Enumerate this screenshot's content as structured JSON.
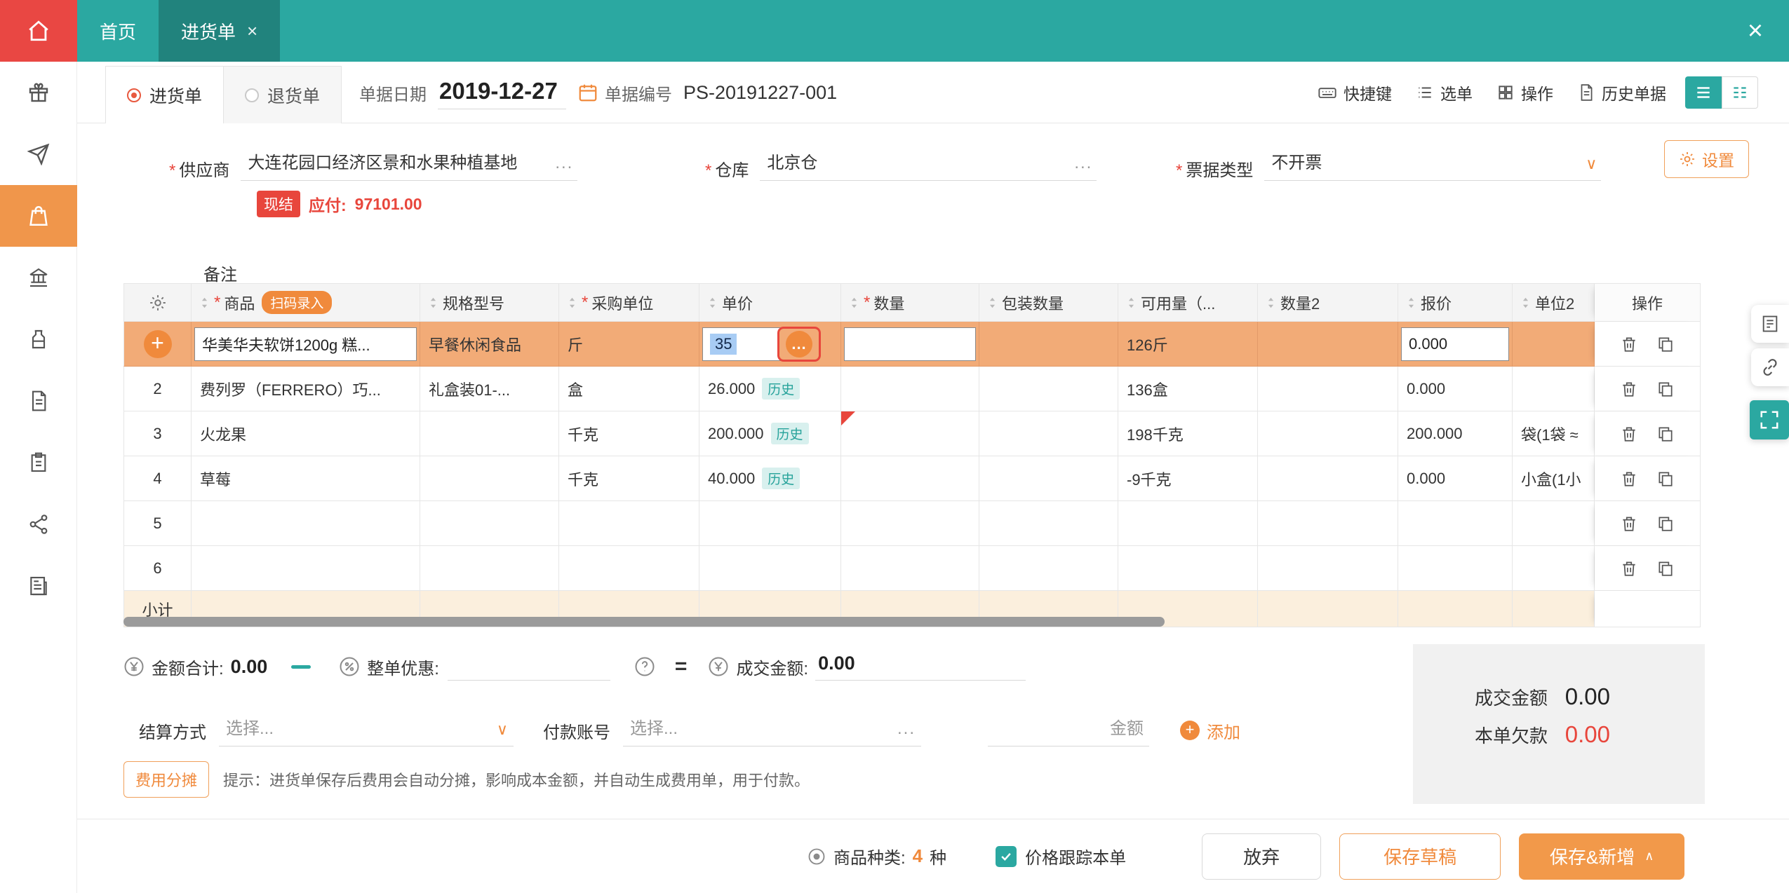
{
  "topbar": {
    "home_tab": "首页",
    "doc_tab": "进货单",
    "tab_close": "×",
    "close": "×"
  },
  "subheader": {
    "purchase_radio": "进货单",
    "return_radio": "退货单",
    "date_label": "单据日期",
    "date_value": "2019-12-27",
    "number_label": "单据编号",
    "number_value": "PS-20191227-001",
    "shortcut": "快捷键",
    "menu": "选单",
    "action": "操作",
    "history": "历史单据"
  },
  "form": {
    "required": "*",
    "supplier_label": "供应商",
    "supplier_value": "大连花园口经济区景和水果种植基地",
    "more": "...",
    "cash_badge": "现结",
    "payable_label": "应付:",
    "payable_value": "97101.00",
    "remark_label": "备注",
    "warehouse_label": "仓库",
    "warehouse_value": "北京仓",
    "invoice_label": "票据类型",
    "invoice_value": "不开票",
    "chevron": "∨",
    "settings": "设置"
  },
  "table": {
    "headers": {
      "product": "商品",
      "spec": "规格型号",
      "unit": "采购单位",
      "price": "单价",
      "qty": "数量",
      "pack": "包装数量",
      "avail": "可用量（...",
      "qty2": "数量2",
      "quote": "报价",
      "unit2": "单位2",
      "ops": "操作"
    },
    "scan_badge": "扫码录入",
    "history_badge": "历史",
    "plus": "+",
    "dots": "...",
    "subtotal": "小计",
    "rows": [
      {
        "product": "华美华夫软饼1200g 糕...",
        "spec": "早餐休闲食品",
        "unit": "斤",
        "price": "35",
        "avail": "126斤",
        "quote": "0.000"
      },
      {
        "num": "2",
        "product": "费列罗（FERRERO）巧...",
        "spec": "礼盒装01-...",
        "unit": "盒",
        "price": "26.000",
        "avail": "136盒",
        "quote": "0.000"
      },
      {
        "num": "3",
        "product": "火龙果",
        "unit": "千克",
        "price": "200.000",
        "avail": "198千克",
        "quote": "200.000",
        "unit2": "袋(1袋 ≈"
      },
      {
        "num": "4",
        "product": "草莓",
        "unit": "千克",
        "price": "40.000",
        "avail": "-9千克",
        "quote": "0.000",
        "unit2": "小盒(1小"
      },
      {
        "num": "5"
      },
      {
        "num": "6"
      }
    ]
  },
  "totals": {
    "amount_label": "金额合计:",
    "amount_value": "0.00",
    "discount_label": "整单优惠:",
    "question": "?",
    "equals": "=",
    "deal_label": "成交金额:",
    "deal_value": "0.00"
  },
  "payment": {
    "method_label": "结算方式",
    "method_placeholder": "选择...",
    "chevron": "∨",
    "account_label": "付款账号",
    "account_placeholder": "选择...",
    "more": "...",
    "amount_placeholder": "金额",
    "plus": "+",
    "add": "添加"
  },
  "fee": {
    "button": "费用分摊",
    "tip": "提示：进货单保存后费用会自动分摊，影响成本金额，并自动生成费用单，用于付款。"
  },
  "summary": {
    "deal_label": "成交金额",
    "deal_value": "0.00",
    "debt_label": "本单欠款",
    "debt_value": "0.00"
  },
  "footer": {
    "category_label": "商品种类:",
    "category_value": "4",
    "category_unit": "种",
    "track": "价格跟踪本单",
    "discard": "放弃",
    "draft": "保存草稿",
    "save_new": "保存&新增",
    "chevron_up": "∧"
  },
  "colors": {
    "teal": "#2BA8A1",
    "orange": "#F08A3C",
    "red": "#E8463C"
  }
}
